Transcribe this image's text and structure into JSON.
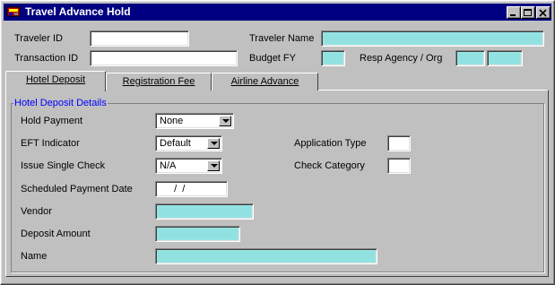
{
  "window": {
    "title": "Travel Advance Hold",
    "controls": [
      "minimize-icon",
      "maximize-icon",
      "close-icon"
    ]
  },
  "header": {
    "traveler_id_label": "Traveler ID",
    "traveler_id_value": "",
    "transaction_id_label": "Transaction ID",
    "transaction_id_value": "",
    "traveler_name_label": "Traveler Name",
    "traveler_name_value": "",
    "budget_fy_label": "Budget FY",
    "budget_fy_value": "",
    "resp_agency_label": "Resp Agency / Org",
    "resp_agency_value": "",
    "resp_org_value": ""
  },
  "tabs": [
    {
      "label": "Hotel Deposit",
      "active": true
    },
    {
      "label": "Registration Fee",
      "active": false
    },
    {
      "label": "Airline Advance",
      "active": false
    }
  ],
  "group": {
    "title": "Hotel Deposit Details",
    "hold_payment_label": "Hold Payment",
    "hold_payment_value": "None",
    "eft_indicator_label": "EFT Indicator",
    "eft_indicator_value": "Default",
    "issue_single_check_label": "Issue Single Check",
    "issue_single_check_value": "N/A",
    "scheduled_payment_date_label": "Scheduled Payment Date",
    "scheduled_payment_date_value": "  /  /",
    "vendor_label": "Vendor",
    "vendor_value": "",
    "deposit_amount_label": "Deposit Amount",
    "deposit_amount_value": "",
    "name_label": "Name",
    "name_value": "",
    "application_type_label": "Application Type",
    "application_type_value": "",
    "check_category_label": "Check Category",
    "check_category_value": ""
  },
  "colors": {
    "titlebar": "#000080",
    "readonly_field": "#99e6e6",
    "group_title": "#0000ff",
    "window_bg": "#c0c0c0"
  }
}
